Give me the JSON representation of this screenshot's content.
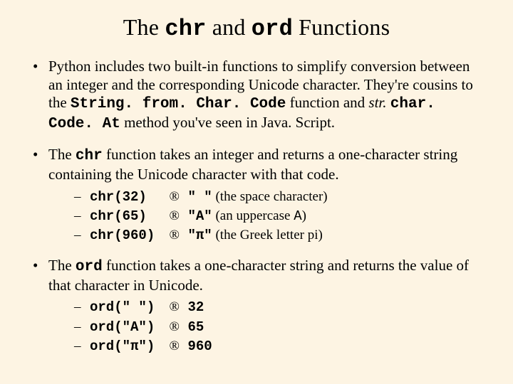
{
  "title": {
    "pre": "The ",
    "code1": "chr",
    "mid": " and ",
    "code2": "ord",
    "post": " Functions"
  },
  "bullet1": {
    "t1": "Python includes two built-in functions to simplify conversion between an integer and the corresponding Unicode character. They're cousins to the ",
    "c1": "String. from. Char. Code",
    "t2": " function and ",
    "i1": "str. ",
    "c2": "char. Code. At",
    "t3": " method you've seen in Java. Script."
  },
  "bullet2": {
    "t1": "The ",
    "c1": "chr",
    "t2": " function takes an integer and returns a one-character string containing the Unicode character with that code."
  },
  "chr_rows": [
    {
      "code": "chr(32)",
      "arrow": "®",
      "out_q": "\" \"",
      "out_t": " (the space character)"
    },
    {
      "code": "chr(65)",
      "arrow": "®",
      "out_q": "\"A\"",
      "out_t": " (an uppercase ",
      "out_c": "A",
      "out_t2": ")"
    },
    {
      "code": "chr(960)",
      "arrow": "®",
      "out_q": "\"π\"",
      "out_t": " (the Greek letter pi)"
    }
  ],
  "bullet3": {
    "t1": "The ",
    "c1": "ord",
    "t2": " function takes a one-character string and returns the value of that character in Unicode."
  },
  "ord_rows": [
    {
      "code": "ord(\" \")",
      "arrow": "®",
      "out": "32"
    },
    {
      "code": "ord(\"A\")",
      "arrow": "®",
      "out": "65"
    },
    {
      "code": "ord(\"π\")",
      "arrow": "®",
      "out": "960"
    }
  ]
}
